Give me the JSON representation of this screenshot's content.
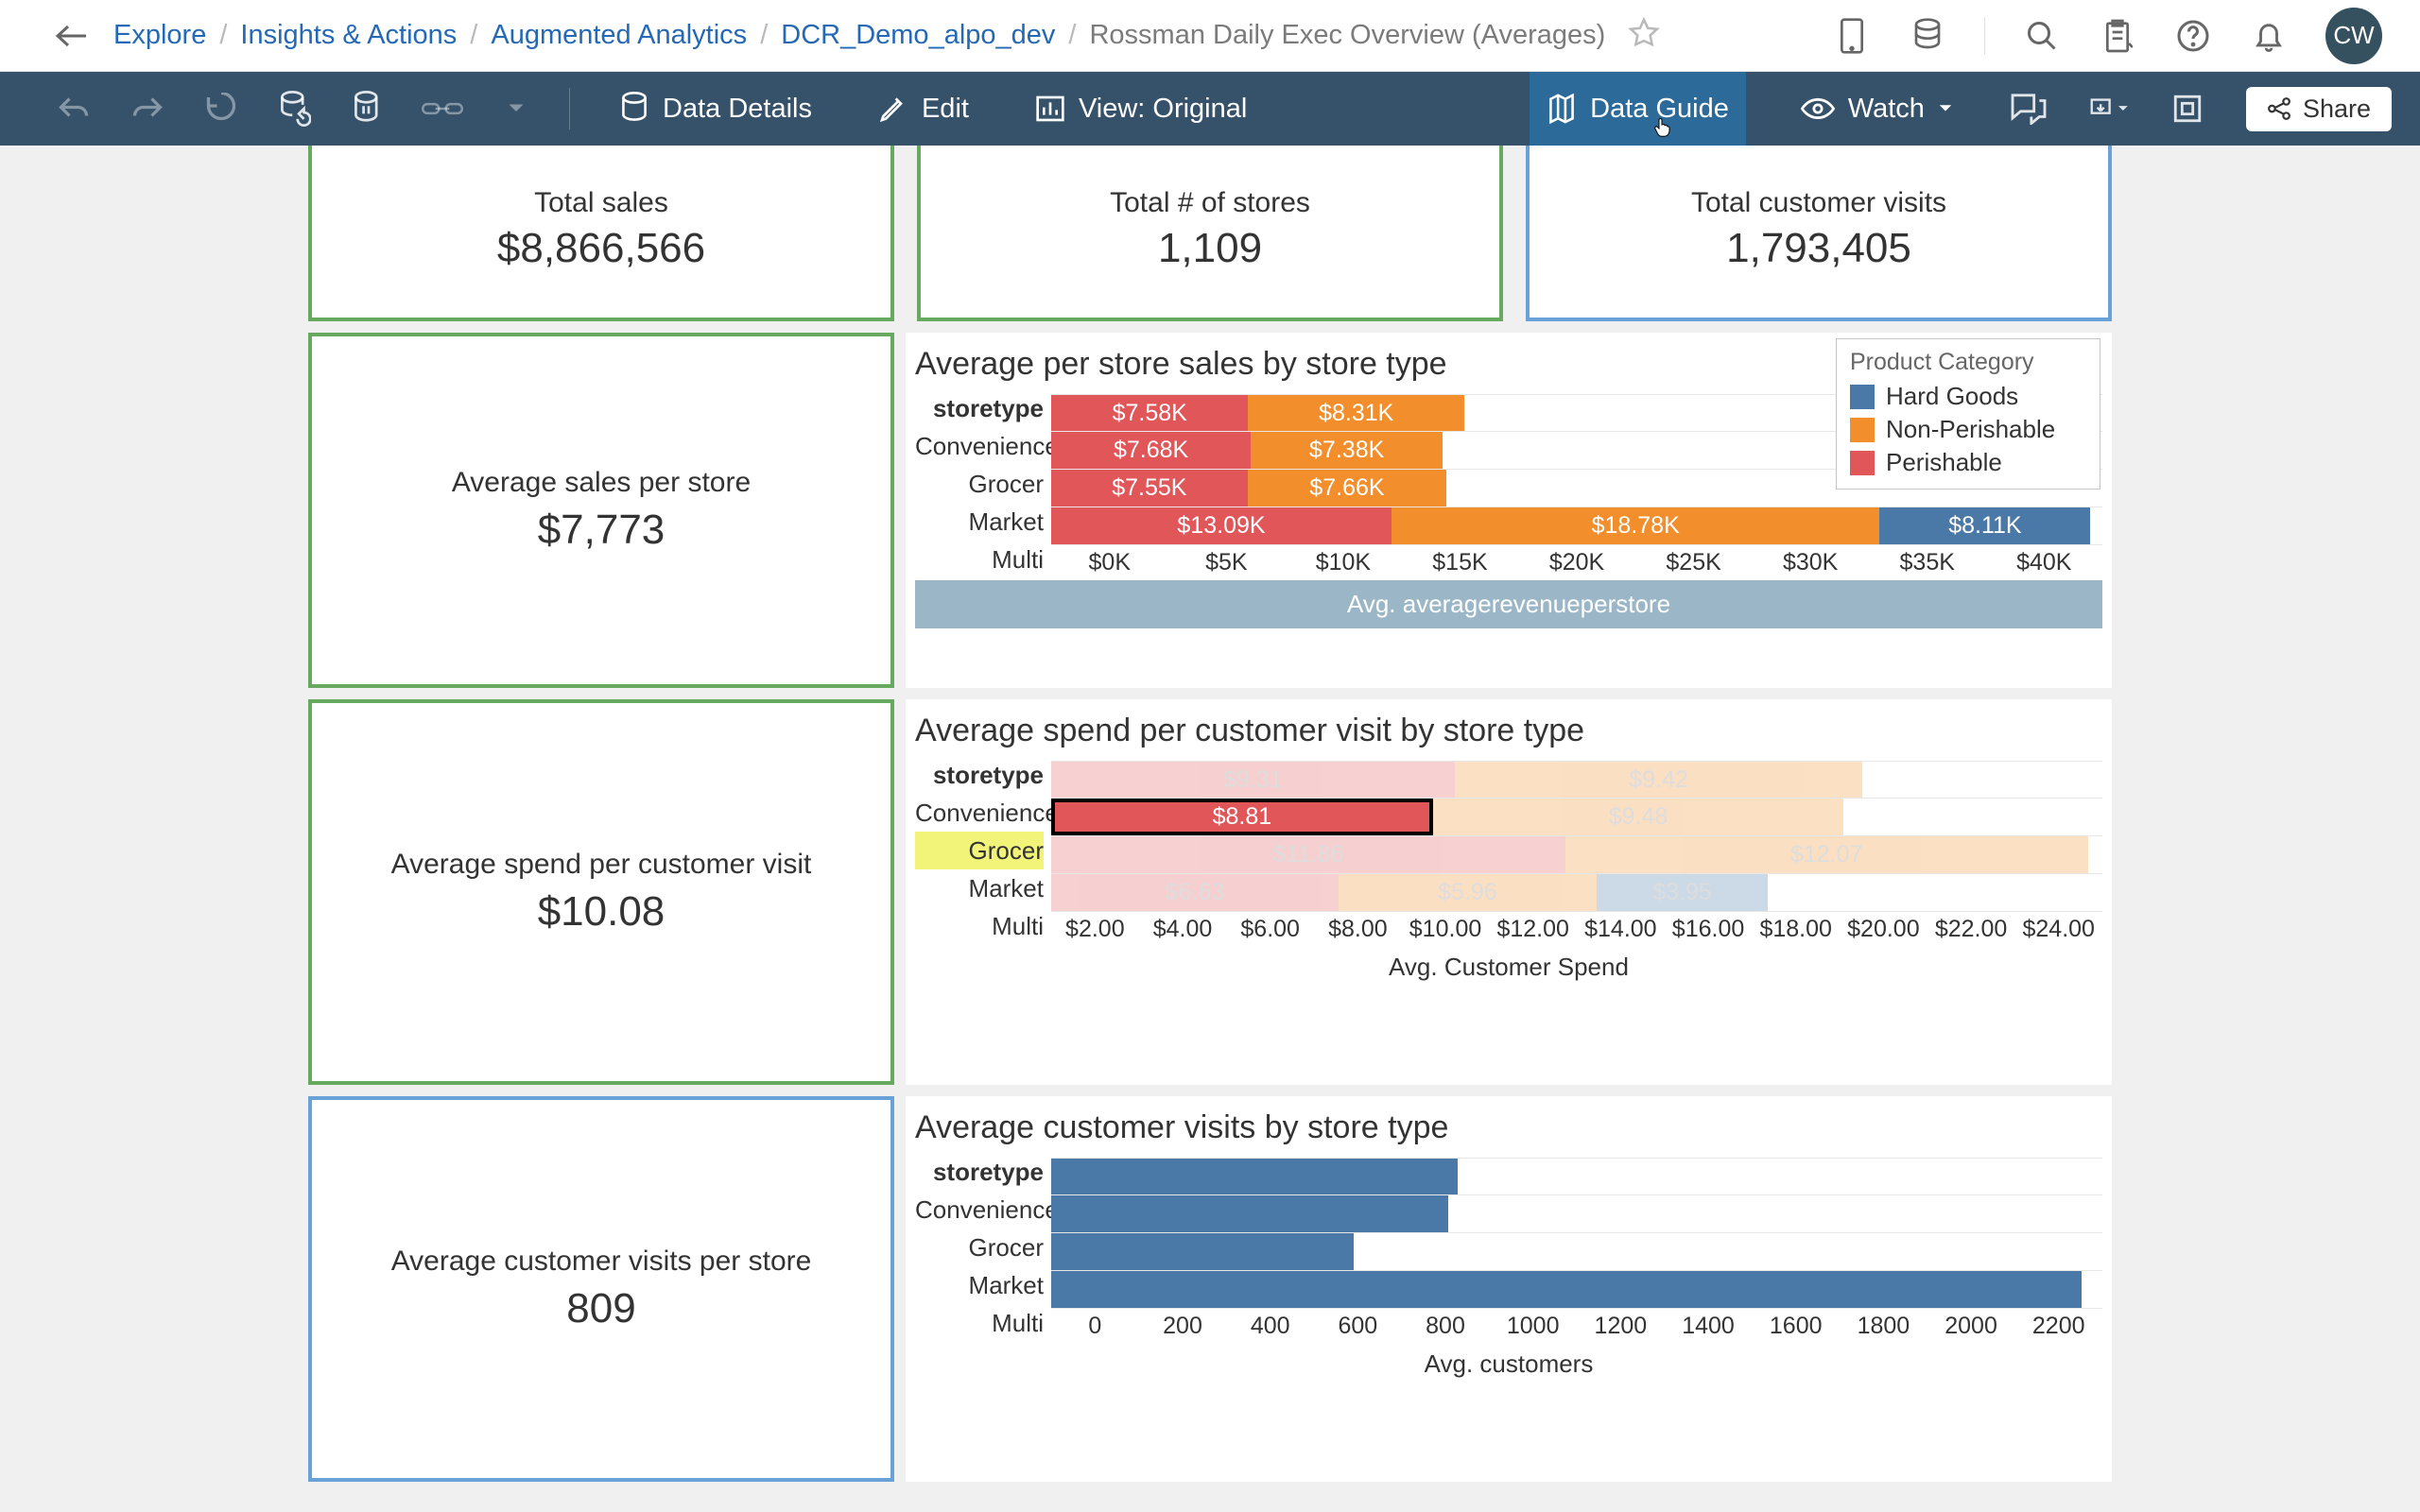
{
  "breadcrumbs": {
    "items": [
      "Explore",
      "Insights & Actions",
      "Augmented Analytics",
      "DCR_Demo_alpo_dev"
    ],
    "current": "Rossman Daily Exec Overview (Averages)"
  },
  "avatar_initials": "CW",
  "actionbar": {
    "data_details": "Data Details",
    "edit": "Edit",
    "view_label": "View: Original",
    "data_guide": "Data Guide",
    "watch": "Watch",
    "share": "Share"
  },
  "kpi_top": [
    {
      "label": "Total sales",
      "value": "$8,866,566",
      "variant": "green"
    },
    {
      "label": "Total # of stores",
      "value": "1,109",
      "variant": "green"
    },
    {
      "label": "Total customer visits",
      "value": "1,793,405",
      "variant": "blue"
    }
  ],
  "kpi_side": [
    {
      "label": "Average sales per store",
      "value": "$7,773",
      "variant": "green"
    },
    {
      "label": "Average spend per customer visit",
      "value": "$10.08",
      "variant": "green"
    },
    {
      "label": "Average customer visits per store",
      "value": "809",
      "variant": "blue"
    }
  ],
  "legend": {
    "title": "Product Category",
    "items": [
      {
        "name": "Hard Goods",
        "color": "#4a79a7"
      },
      {
        "name": "Non-Perishable",
        "color": "#f28e2b"
      },
      {
        "name": "Perishable",
        "color": "#e15759"
      }
    ]
  },
  "panels": {
    "sales": {
      "title": "Average per store sales by store type",
      "yhead": "storetype",
      "xlabel": "Avg. averagerevenueperstore"
    },
    "spend": {
      "title": "Average spend per customer visit by store type",
      "yhead": "storetype",
      "xlabel": "Avg. Customer Spend"
    },
    "visits": {
      "title": "Average customer visits by store type",
      "yhead": "storetype",
      "xlabel": "Avg. customers"
    }
  },
  "chart_data": [
    {
      "id": "sales",
      "type": "bar",
      "stacked": true,
      "categories": [
        "Convenience",
        "Grocer",
        "Market",
        "Multi"
      ],
      "series": [
        {
          "name": "Perishable",
          "color": "#e15759",
          "values": [
            7.58,
            7.68,
            7.55,
            13.09
          ],
          "labels": [
            "$7.58K",
            "$7.68K",
            "$7.55K",
            "$13.09K"
          ]
        },
        {
          "name": "Non-Perishable",
          "color": "#f28e2b",
          "values": [
            8.31,
            7.38,
            7.66,
            18.78
          ],
          "labels": [
            "$8.31K",
            "$7.38K",
            "$7.66K",
            "$18.78K"
          ]
        },
        {
          "name": "Hard Goods",
          "color": "#4a79a7",
          "values": [
            0,
            0,
            0,
            8.11
          ],
          "labels": [
            "",
            "",
            "",
            "$8.11K"
          ]
        }
      ],
      "xticks": [
        "$0K",
        "$5K",
        "$10K",
        "$15K",
        "$20K",
        "$25K",
        "$30K",
        "$35K",
        "$40K"
      ],
      "xlim": [
        0,
        40
      ]
    },
    {
      "id": "spend",
      "type": "bar",
      "stacked": true,
      "highlight_category": "Grocer",
      "highlight_segment": "Perishable",
      "categories": [
        "Convenience",
        "Grocer",
        "Market",
        "Multi"
      ],
      "series": [
        {
          "name": "Perishable",
          "color": "#e15759",
          "values": [
            9.31,
            8.81,
            11.86,
            6.63
          ],
          "labels": [
            "$9.31",
            "$8.81",
            "$11.86",
            "$6.63"
          ]
        },
        {
          "name": "Non-Perishable",
          "color": "#f28e2b",
          "values": [
            9.42,
            9.48,
            12.07,
            5.96
          ],
          "labels": [
            "$9.42",
            "$9.48",
            "$12.07",
            "$5.96"
          ]
        },
        {
          "name": "Hard Goods",
          "color": "#4a79a7",
          "values": [
            0,
            0,
            0,
            3.95
          ],
          "labels": [
            "",
            "",
            "",
            "$3.95"
          ]
        }
      ],
      "xticks": [
        "$2.00",
        "$4.00",
        "$6.00",
        "$8.00",
        "$10.00",
        "$12.00",
        "$14.00",
        "$16.00",
        "$18.00",
        "$20.00",
        "$22.00",
        "$24.00"
      ],
      "xlim": [
        0,
        24
      ]
    },
    {
      "id": "visits",
      "type": "bar",
      "stacked": false,
      "categories": [
        "Convenience",
        "Grocer",
        "Market",
        "Multi"
      ],
      "series": [
        {
          "name": "Customers",
          "color": "#4a79a7",
          "values": [
            860,
            840,
            640,
            2180
          ],
          "labels": [
            "",
            "",
            "",
            ""
          ]
        }
      ],
      "xticks": [
        "0",
        "200",
        "400",
        "600",
        "800",
        "1000",
        "1200",
        "1400",
        "1600",
        "1800",
        "2000",
        "2200"
      ],
      "xlim": [
        0,
        2200
      ]
    }
  ]
}
